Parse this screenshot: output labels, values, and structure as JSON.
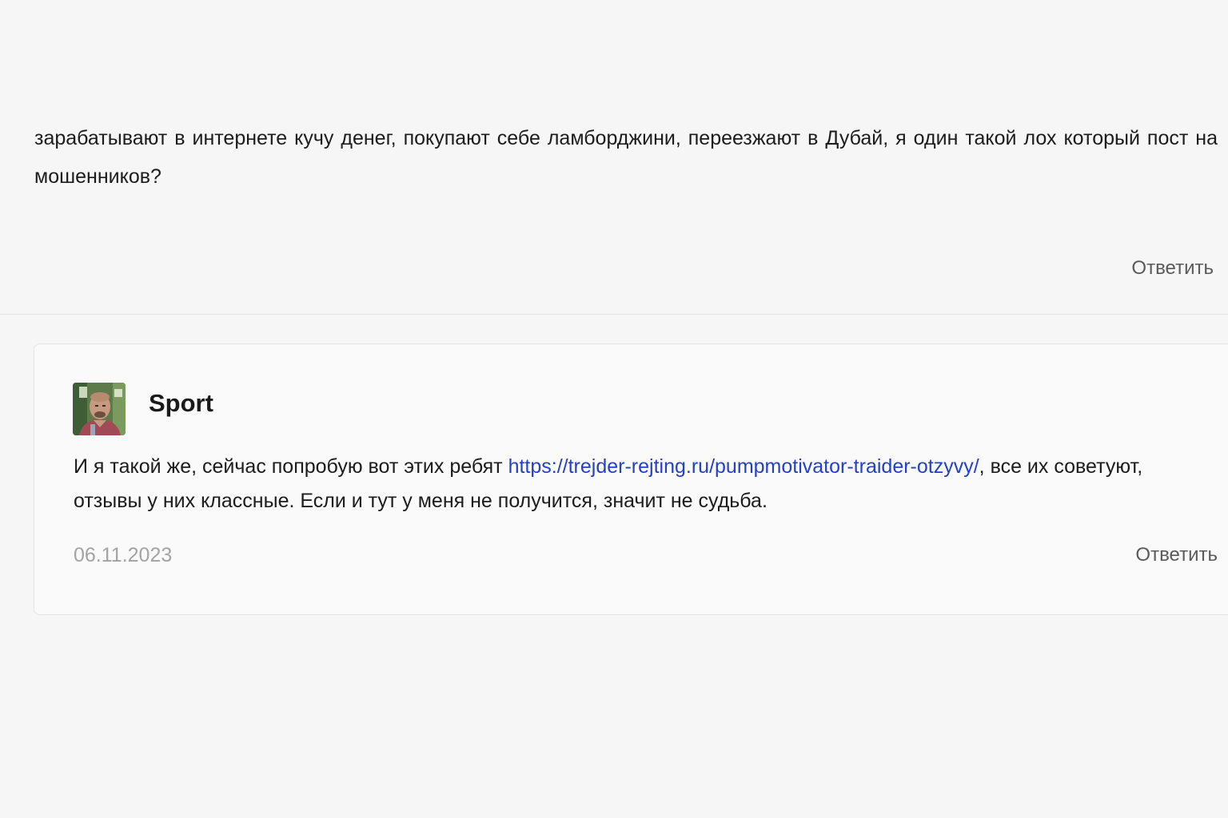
{
  "top_comment": {
    "text": "зарабатывают в интернете кучу денег, покупают себе ламборджини, переезжают в Дубай, я один такой лох который пост на мошенников?",
    "reply_label": "Ответить"
  },
  "reply_comment": {
    "author": "Sport",
    "text_before_link": "И я такой же, сейчас попробую вот этих ребят ",
    "link_text": "https://trejder-rejting.ru/pumpmotivator-traider-otzyvy/",
    "text_after_link": ", все их советуют, отзывы у них классные. Если и тут у меня не получится, значит не судьба.",
    "date": "06.11.2023",
    "reply_label": "Ответить",
    "link_color": "#2440c8"
  }
}
